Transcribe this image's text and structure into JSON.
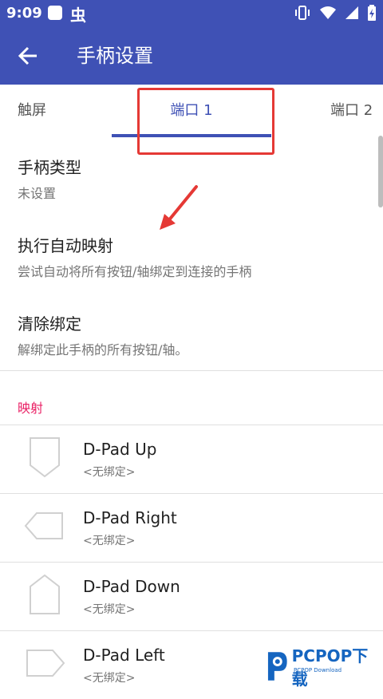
{
  "status": {
    "time": "9:09",
    "app_glyph": "虫"
  },
  "app_bar": {
    "title": "手柄设置"
  },
  "tabs": [
    {
      "label": "触屏"
    },
    {
      "label": "端口 1",
      "selected": true
    },
    {
      "label": "端口 2"
    }
  ],
  "prefs": [
    {
      "title": "手柄类型",
      "summary": "未设置"
    },
    {
      "title": "执行自动映射",
      "summary": "尝试自动将所有按钮/轴绑定到连接的手柄"
    },
    {
      "title": "清除绑定",
      "summary": "解绑定此手柄的所有按钮/轴。"
    }
  ],
  "section": {
    "header": "映射"
  },
  "mappings": [
    {
      "name": "D-Pad Up",
      "binding": "<无绑定>",
      "icon": "dpad-up-icon"
    },
    {
      "name": "D-Pad Right",
      "binding": "<无绑定>",
      "icon": "dpad-right-icon"
    },
    {
      "name": "D-Pad Down",
      "binding": "<无绑定>",
      "icon": "dpad-down-icon"
    },
    {
      "name": "D-Pad Left",
      "binding": "<无绑定>",
      "icon": "dpad-left-icon"
    }
  ],
  "watermark": {
    "text": "PCPOP下载",
    "sub": "PCPOP Download"
  },
  "colors": {
    "primary": "#3f51b5",
    "accent": "#e91e63",
    "annotation": "#e53935"
  }
}
